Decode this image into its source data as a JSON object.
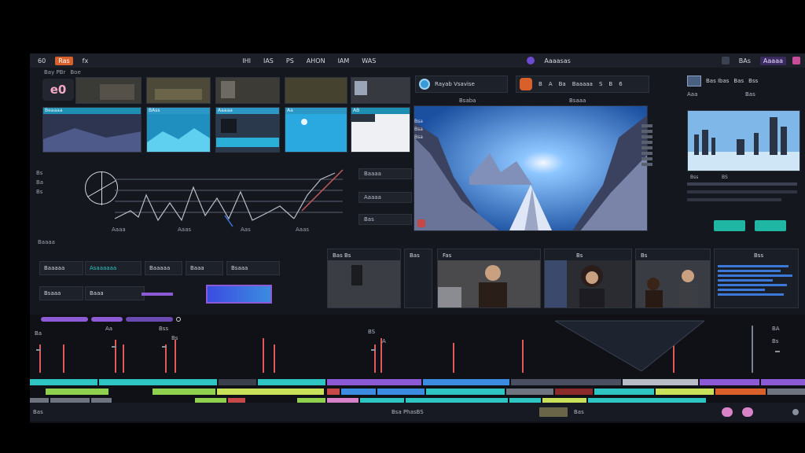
{
  "topbar": {
    "items": [
      "60",
      "Ras",
      "fx",
      "IHI",
      "IAS",
      "PS",
      "AHON",
      "IAM",
      "WAS",
      "Aaaasas",
      "BAs",
      "Aaaaa"
    ]
  },
  "browser": {
    "brand": "e0",
    "subtabs": [
      "Bay PBr",
      "Boe"
    ],
    "thumb_captions": [
      "Beaaaa",
      "BAss",
      "Aaaaa",
      "Aa",
      "AB"
    ],
    "thumb_title": "Rs"
  },
  "wave": {
    "labels": [
      "Bs",
      "Ba",
      "Bs",
      "Aaaa",
      "Aaas",
      "Aas",
      "Aaas",
      "Basa",
      "Aaaas"
    ],
    "buttons": [
      "Baaaa",
      "Aaaaa",
      "Bas"
    ]
  },
  "preview": {
    "title": "Rayab Vsavise",
    "subtitle": "Bsaba",
    "tools": [
      "B",
      "A",
      "Ba",
      "Baaaaa",
      "S",
      "B",
      "6"
    ],
    "tool_label": "Bsaaa",
    "side_labels": [
      "Bsa",
      "Bsa",
      "Bsa"
    ]
  },
  "inspector": {
    "title": "Bas Ibas",
    "labels": [
      "Bas",
      "Bss",
      "Aaa",
      "Bas",
      "BS"
    ],
    "value_label": "Bss"
  },
  "effects": {
    "label": "Baaaa",
    "boxes": [
      "Baaaaa",
      "Asaaaaaa",
      "Baaaaa",
      "Baaa",
      "Bsaaa"
    ],
    "second_row": [
      "Bsaaa",
      "Baaa"
    ],
    "panels": [
      "Bas Bs",
      "Bas",
      "Fas",
      "Bs",
      "Bs",
      "Bss"
    ]
  },
  "timeline": {
    "labels": [
      "Ba",
      "Aa",
      "Bss",
      "Bs",
      "BS",
      "A",
      "BA",
      "Bs",
      "Bs",
      "AB"
    ],
    "bottom_labels": [
      "Bas",
      "Bsa PhasBS",
      "Bas"
    ],
    "colors": {
      "teal": "#2ec4c1",
      "green": "#8fd14f",
      "purple": "#8d5ad6",
      "blue": "#3b8ce0",
      "red": "#c74848",
      "grey": "#6e7480"
    }
  }
}
